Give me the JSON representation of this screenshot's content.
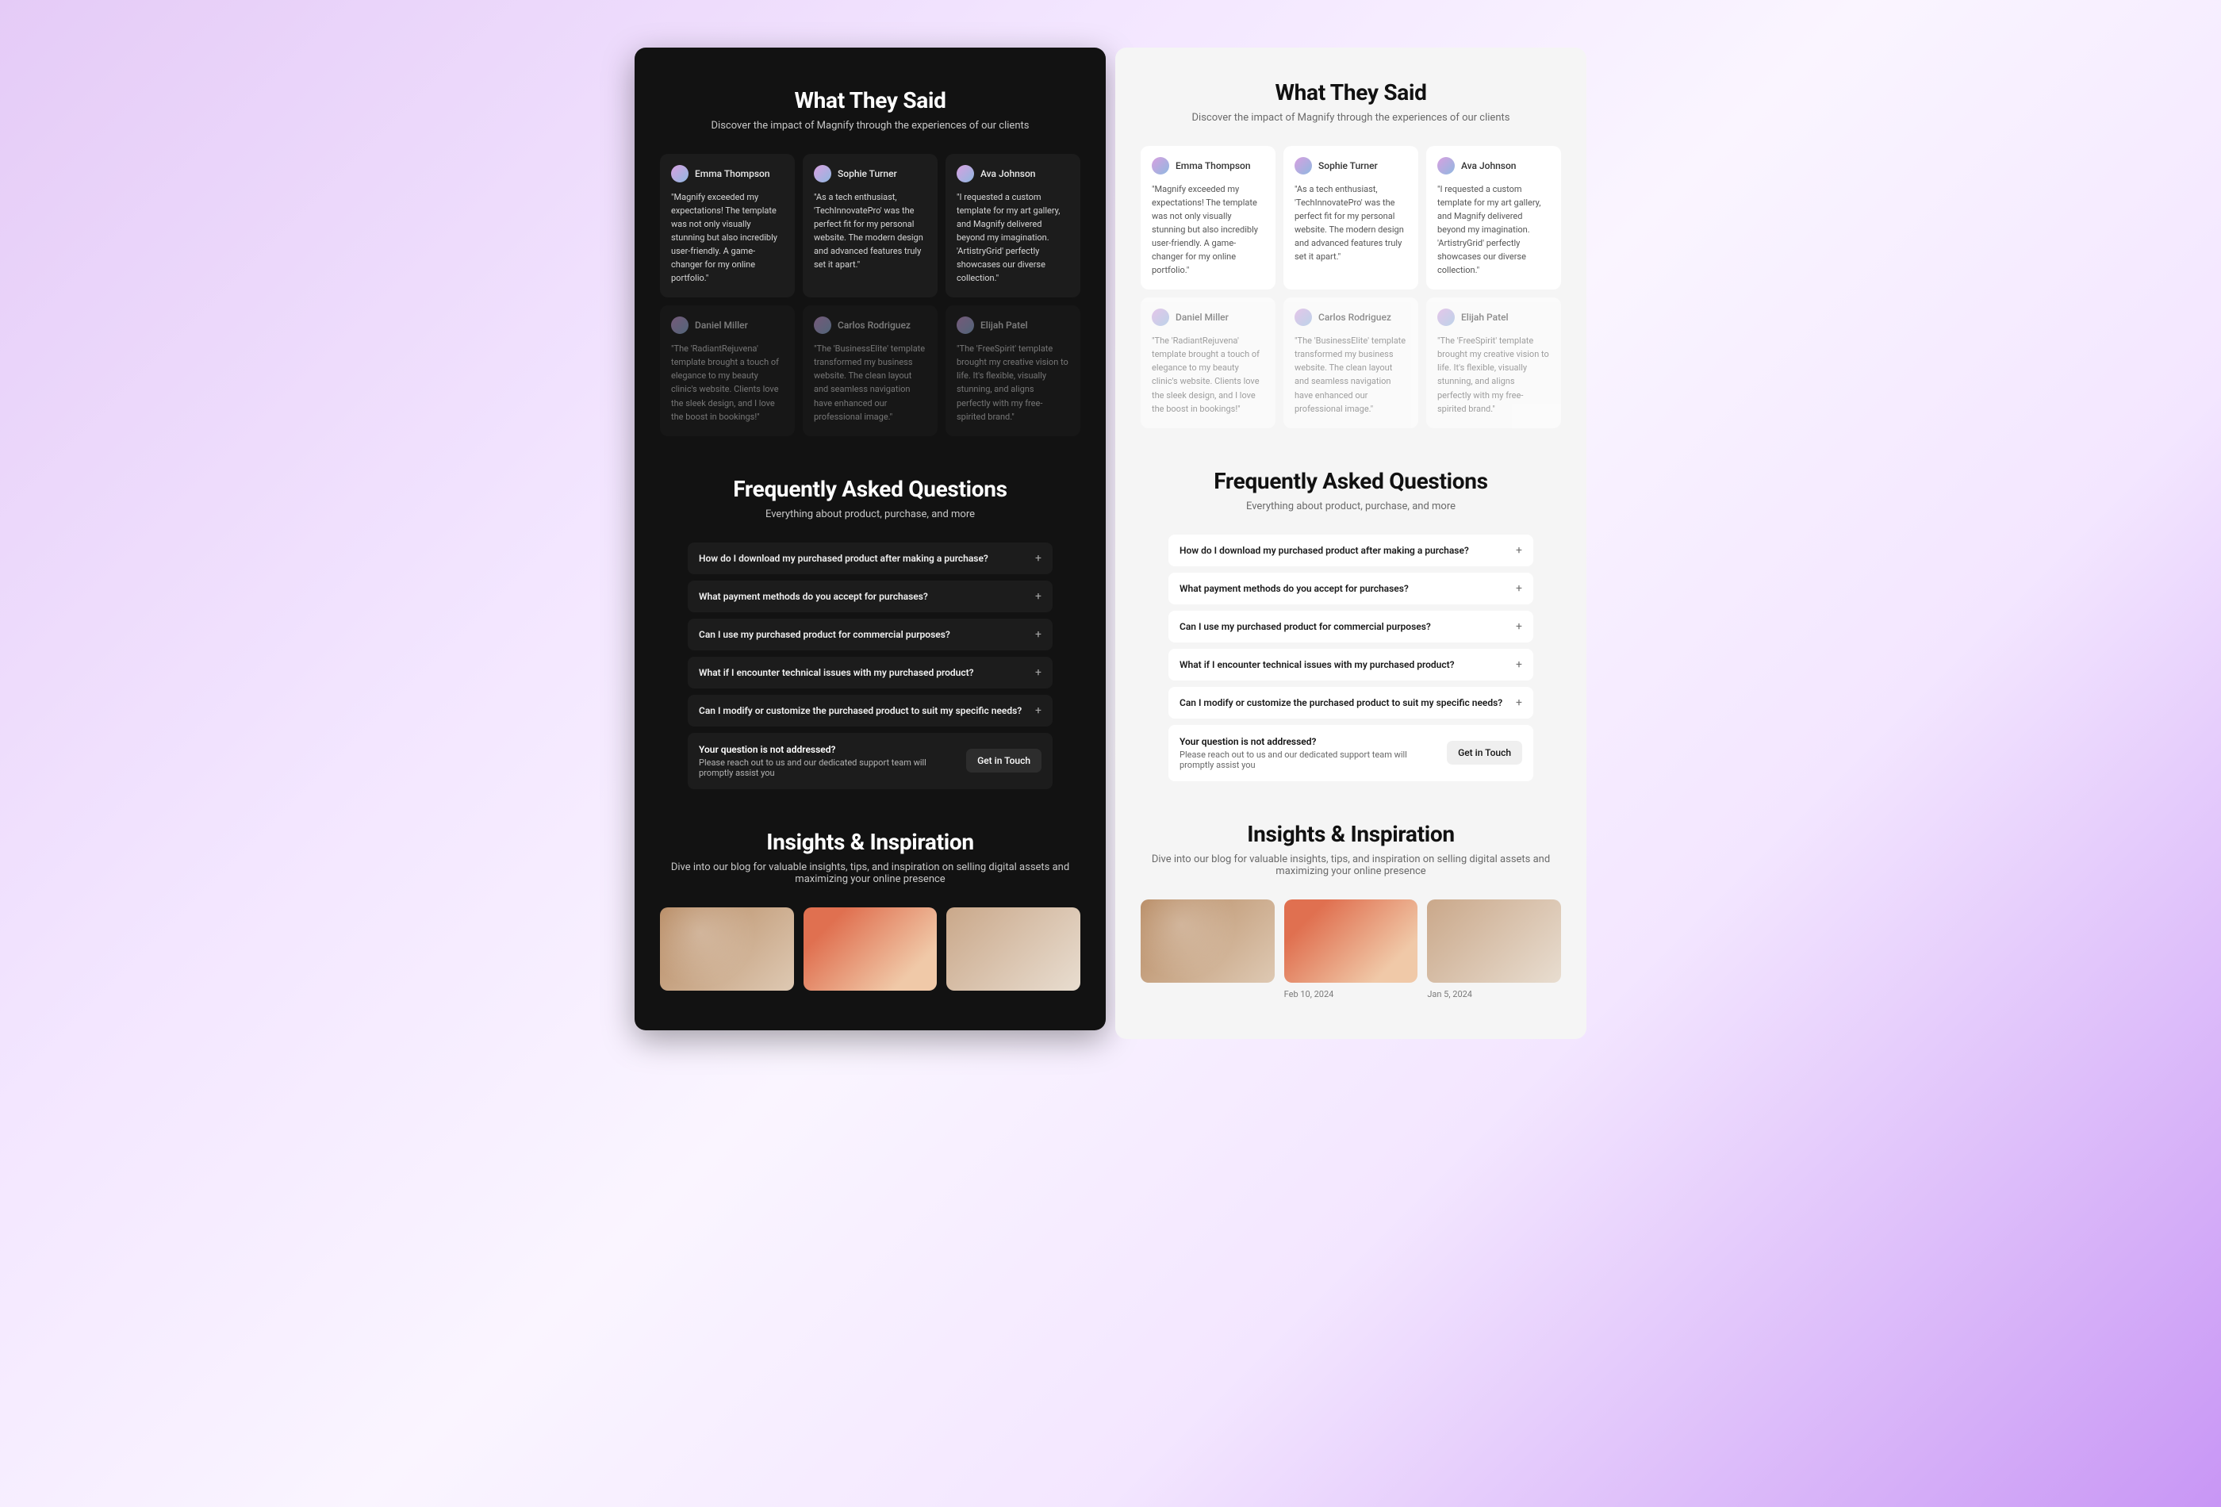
{
  "testimonials": {
    "heading": "What They Said",
    "sub": "Discover the impact of Magnify through the experiences of our clients",
    "cards": [
      {
        "name": "Emma Thompson",
        "quote": "\"Magnify exceeded my expectations! The template was not only visually stunning but also incredibly user-friendly. A game-changer for my online portfolio.\"",
        "faded": false
      },
      {
        "name": "Sophie Turner",
        "quote": "\"As a tech enthusiast, 'TechInnovatePro' was the perfect fit for my personal website. The modern design and advanced features truly set it apart.\"",
        "faded": false
      },
      {
        "name": "Ava Johnson",
        "quote": "\"I requested a custom template for my art gallery, and Magnify delivered beyond my imagination. 'ArtistryGrid' perfectly showcases our diverse collection.\"",
        "faded": false
      },
      {
        "name": "Daniel Miller",
        "quote": "\"The 'RadiantRejuvena' template brought a touch of elegance to my beauty clinic's website. Clients love the sleek design, and I love the boost in bookings!\"",
        "faded": true
      },
      {
        "name": "Carlos Rodriguez",
        "quote": "\"The 'BusinessElite' template transformed my business website. The clean layout and seamless navigation have enhanced our professional image.\"",
        "faded": true
      },
      {
        "name": "Elijah Patel",
        "quote": "\"The 'FreeSpirit' template brought my creative vision to life. It's flexible, visually stunning, and aligns perfectly with my free-spirited brand.\"",
        "faded": true
      }
    ]
  },
  "faq": {
    "heading": "Frequently Asked Questions",
    "sub": "Everything about product, purchase, and more",
    "items": [
      "How do I download my purchased product after making a purchase?",
      "What payment methods do you accept for purchases?",
      "Can I use my purchased product for commercial purposes?",
      "What if I encounter technical issues with my purchased product?",
      "Can I modify or customize the purchased product to suit my specific needs?"
    ],
    "foot_title": "Your question is not addressed?",
    "foot_sub": "Please reach out to us and our dedicated support team will promptly assist you",
    "cta": "Get in Touch",
    "plus": "+"
  },
  "blog": {
    "heading": "Insights & Inspiration",
    "sub": "Dive into our blog for valuable insights, tips, and inspiration on selling digital assets and maximizing your online presence",
    "cards": [
      {
        "date": ""
      },
      {
        "date": "Feb 10, 2024"
      },
      {
        "date": "Jan 5, 2024"
      }
    ]
  }
}
